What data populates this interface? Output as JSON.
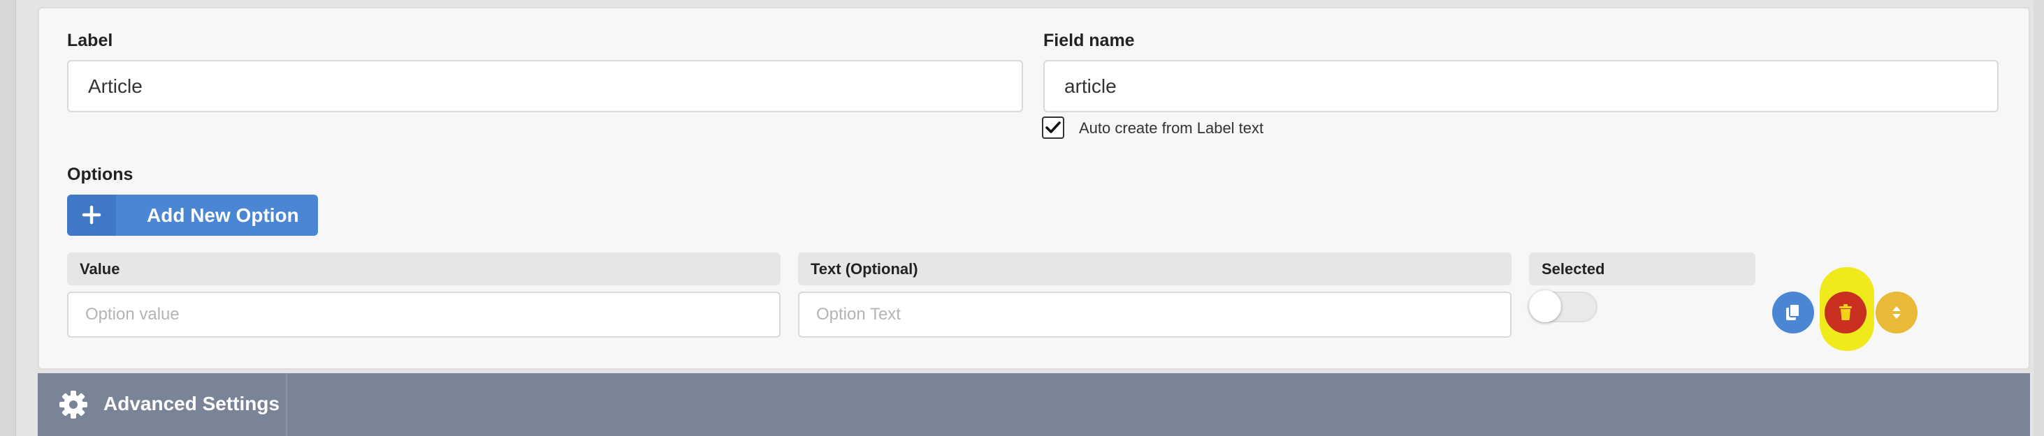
{
  "label_field": {
    "label": "Label",
    "value": "Article"
  },
  "field_name": {
    "label": "Field name",
    "value": "article",
    "auto_create_label": "Auto create from Label text",
    "auto_create_checked": true
  },
  "options": {
    "title": "Options",
    "add_button_label": "Add New Option",
    "columns": [
      "Value",
      "Text (Optional)",
      "Selected"
    ],
    "value_placeholder": "Option value",
    "text_placeholder": "Option Text",
    "selected": false
  },
  "row_actions": {
    "duplicate_icon": "copy-icon",
    "delete_icon": "trash-icon",
    "move_icon": "sort-icon",
    "colors": {
      "duplicate": "#4a86d4",
      "delete": "#c9301f",
      "move": "#eab93a",
      "highlight": "#f0ea1d"
    }
  },
  "advanced": {
    "label": "Advanced Settings",
    "icon": "gear-icon"
  }
}
